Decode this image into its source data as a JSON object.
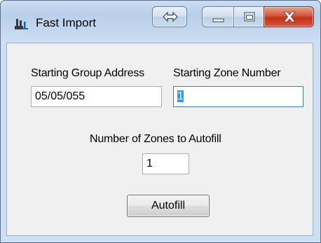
{
  "window": {
    "title": "Fast Import"
  },
  "form": {
    "starting_group_address_label": "Starting Group Address",
    "starting_group_address_value": "05/05/055",
    "starting_zone_number_label": "Starting Zone Number",
    "starting_zone_number_value": "1",
    "zones_to_autofill_label": "Number of Zones to Autofill",
    "zones_to_autofill_value": "1",
    "autofill_button_label": "Autofill"
  },
  "icons": {
    "app": "app-import-icon",
    "arrows": "left-right-arrow-icon",
    "minimize": "minimize-icon",
    "maximize": "maximize-icon",
    "close": "close-icon"
  },
  "colors": {
    "titlebar": "#c9dcf2",
    "close_button": "#c1321b",
    "focus_border": "#3d7bad",
    "selection": "#3399ff"
  }
}
